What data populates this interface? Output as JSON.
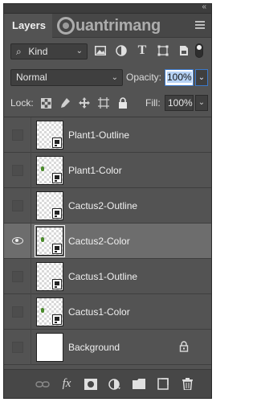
{
  "panel": {
    "tab_label": "Layers",
    "watermark": "uantrimang",
    "collapse_glyph": "«",
    "menu_icon": "panel-menu-icon"
  },
  "filter": {
    "kind_label": "Kind",
    "search_glyph": "⌕",
    "caret": "⌄",
    "icons": [
      "pixel-layer-filter-icon",
      "adjustment-layer-filter-icon",
      "type-layer-filter-icon",
      "shape-layer-filter-icon",
      "smart-object-filter-icon"
    ],
    "type_glyph": "T"
  },
  "blend": {
    "mode": "Normal",
    "caret": "⌄",
    "opacity_label": "Opacity:",
    "opacity_value": "100%",
    "opacity_drop": "⌄"
  },
  "lock": {
    "label": "Lock:",
    "fill_label": "Fill:",
    "fill_value": "100%",
    "fill_drop": "⌄"
  },
  "layers": [
    {
      "name": "Plant1-Outline",
      "visible": false,
      "selected": false,
      "thumb": "transparent"
    },
    {
      "name": "Plant1-Color",
      "visible": false,
      "selected": false,
      "thumb": "transparent-plant"
    },
    {
      "name": "Cactus2-Outline",
      "visible": false,
      "selected": false,
      "thumb": "transparent"
    },
    {
      "name": "Cactus2-Color",
      "visible": true,
      "selected": true,
      "thumb": "transparent-plant"
    },
    {
      "name": "Cactus1-Outline",
      "visible": false,
      "selected": false,
      "thumb": "transparent"
    },
    {
      "name": "Cactus1-Color",
      "visible": false,
      "selected": false,
      "thumb": "transparent-plant"
    },
    {
      "name": "Background",
      "visible": false,
      "selected": false,
      "thumb": "white",
      "locked": true
    }
  ],
  "bottom": {
    "fx_label": "fx"
  }
}
